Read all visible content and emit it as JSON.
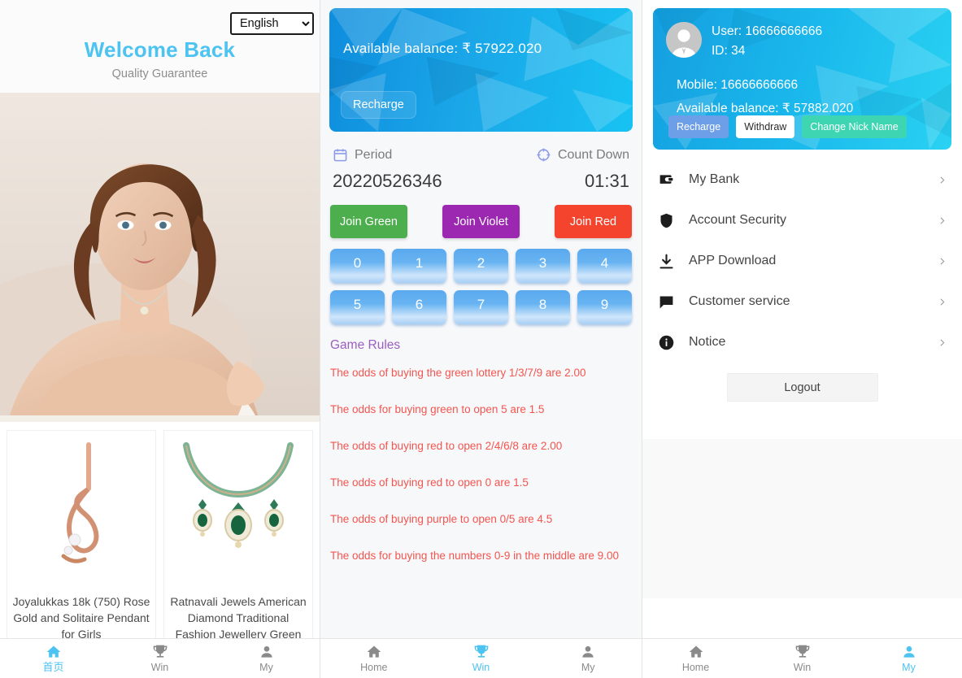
{
  "home": {
    "language_selected": "English",
    "language_options": [
      "English"
    ],
    "title": "Welcome Back",
    "subtitle": "Quality Guarantee",
    "hero_alt": "model-wearing-jewellery",
    "products": [
      {
        "name": "rose-gold-pendant",
        "title": "Joyalukkas 18k (750) Rose Gold and Solitaire Pendant for Girls"
      },
      {
        "name": "green-necklace-set",
        "title": "Ratnavali Jewels American Diamond Traditional Fashion Jewellery Green"
      }
    ],
    "tabs": [
      {
        "icon": "home-icon",
        "label": "首页",
        "active": true
      },
      {
        "icon": "trophy-icon",
        "label": "Win",
        "active": false
      },
      {
        "icon": "person-icon",
        "label": "My",
        "active": false
      }
    ]
  },
  "game": {
    "balance_label": "Available balance: ₹ 57922.020",
    "recharge_label": "Recharge",
    "period_label": "Period",
    "countdown_label": "Count Down",
    "period_value": "20220526346",
    "countdown_value": "01:31",
    "join_buttons": [
      {
        "label": "Join Green",
        "color": "#4cae4c"
      },
      {
        "label": "Join Violet",
        "color": "#9c27b0"
      },
      {
        "label": "Join Red",
        "color": "#f4442e"
      }
    ],
    "numbers": [
      "0",
      "1",
      "2",
      "3",
      "4",
      "5",
      "6",
      "7",
      "8",
      "9"
    ],
    "rules_title": "Game Rules",
    "rules": [
      "The odds of buying the green lottery 1/3/7/9 are 2.00",
      "The odds for buying green to open 5 are 1.5",
      "The odds of buying red to open 2/4/6/8 are 2.00",
      "The odds of buying red to open 0 are 1.5",
      "The odds of buying purple to open 0/5 are 4.5",
      "The odds for buying the numbers 0-9 in the middle are 9.00"
    ],
    "tabs": [
      {
        "icon": "home-icon",
        "label": "Home",
        "active": false
      },
      {
        "icon": "trophy-icon",
        "label": "Win",
        "active": true
      },
      {
        "icon": "person-icon",
        "label": "My",
        "active": false
      }
    ]
  },
  "my": {
    "user_line": "User: 16666666666",
    "id_line": "ID: 34",
    "mobile_line": "Mobile: 16666666666",
    "balance_line": "Available balance: ₹ 57882.020",
    "buttons": [
      {
        "name": "recharge-button",
        "label": "Recharge",
        "color": "#6d9ee8"
      },
      {
        "name": "withdraw-button",
        "label": "Withdraw",
        "color": "#ffffff"
      },
      {
        "name": "change-nick-name-button",
        "label": "Change Nick Name",
        "color": "#3ed5b2"
      }
    ],
    "menu": [
      {
        "icon": "wallet-icon",
        "label": "My Bank"
      },
      {
        "icon": "shield-icon",
        "label": "Account Security"
      },
      {
        "icon": "download-icon",
        "label": "APP Download"
      },
      {
        "icon": "chat-icon",
        "label": "Customer service"
      },
      {
        "icon": "info-icon",
        "label": "Notice"
      }
    ],
    "logout_label": "Logout",
    "tabs": [
      {
        "icon": "home-icon",
        "label": "Home",
        "active": false
      },
      {
        "icon": "trophy-icon",
        "label": "Win",
        "active": false
      },
      {
        "icon": "person-icon",
        "label": "My",
        "active": true
      }
    ]
  },
  "theme": {
    "accent": "#4cc3f0",
    "balance_card_from": "#0e8ddd",
    "balance_card_to": "#17c3f2",
    "rule_text": "#f4554f",
    "rules_title_color": "#9b5fc0"
  }
}
